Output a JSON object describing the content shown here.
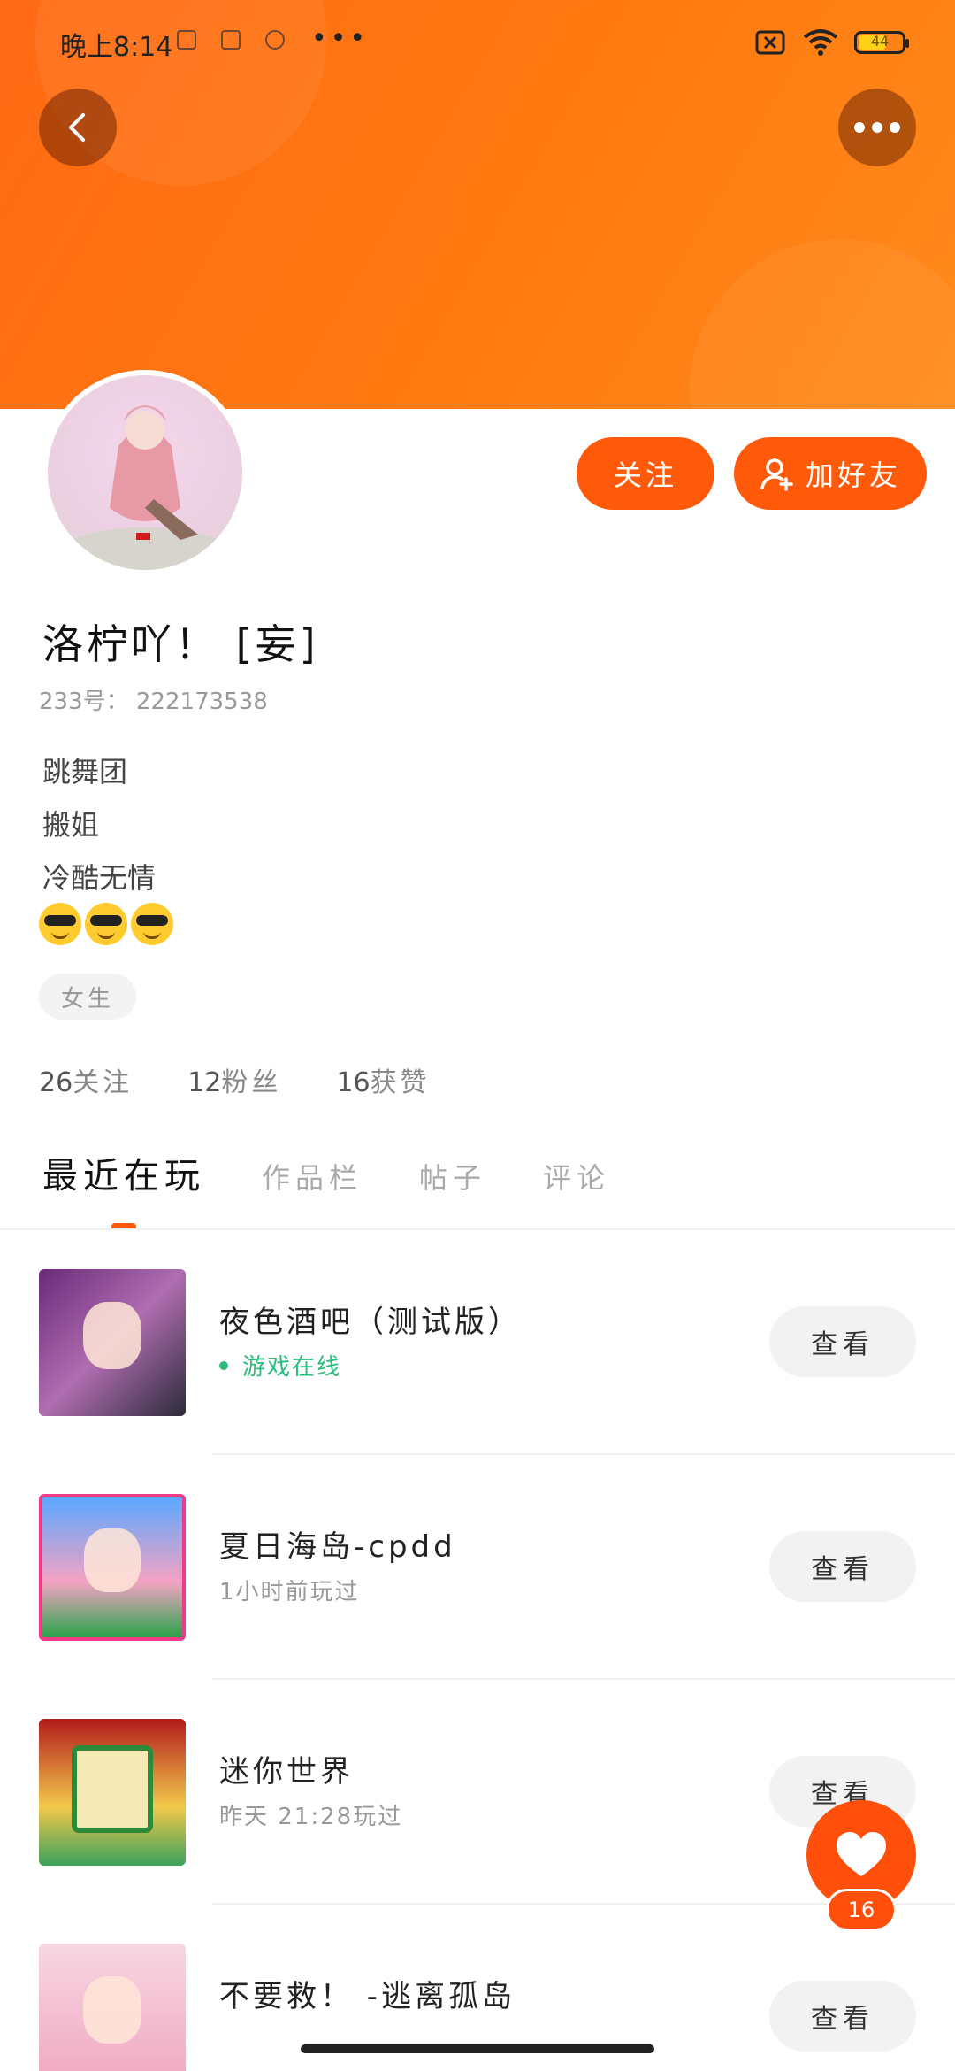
{
  "status_bar": {
    "time": "晚上8:14",
    "more": "•••",
    "battery": "44"
  },
  "profile": {
    "nickname": "洛柠吖！ [妄]",
    "uid_label": "233号：",
    "uid": "222173538",
    "bio_lines": [
      "跳舞团",
      "搬姐",
      "冷酷无情"
    ],
    "emojis": [
      "smiling-face-with-sunglasses",
      "smiling-face-with-sunglasses",
      "smiling-face-with-sunglasses"
    ],
    "tag": "女生",
    "stats": {
      "following_count": "26",
      "following_label": "关注",
      "fans_count": "12",
      "fans_label": "粉丝",
      "likes_count": "16",
      "likes_label": "获赞"
    }
  },
  "actions": {
    "follow": "关注",
    "add_friend": "加好友"
  },
  "tabs": {
    "recent": "最近在玩",
    "works": "作品栏",
    "posts": "帖子",
    "comments": "评论"
  },
  "games": [
    {
      "title": "夜色酒吧（测试版）",
      "subtitle": "游戏在线",
      "online": true,
      "button": "查看"
    },
    {
      "title": "夏日海岛-cpdd",
      "subtitle": "1小时前玩过",
      "online": false,
      "button": "查看"
    },
    {
      "title": "迷你世界",
      "subtitle": "昨天 21:28玩过",
      "online": false,
      "button": "查看"
    },
    {
      "title": "不要救！ -逃离孤岛",
      "subtitle": "",
      "online": false,
      "button": "查看"
    }
  ],
  "fab": {
    "count": "16"
  },
  "colors": {
    "brand": "#ff5a0a",
    "header_start": "#ff6a14",
    "online_green": "#2bbd7e"
  }
}
